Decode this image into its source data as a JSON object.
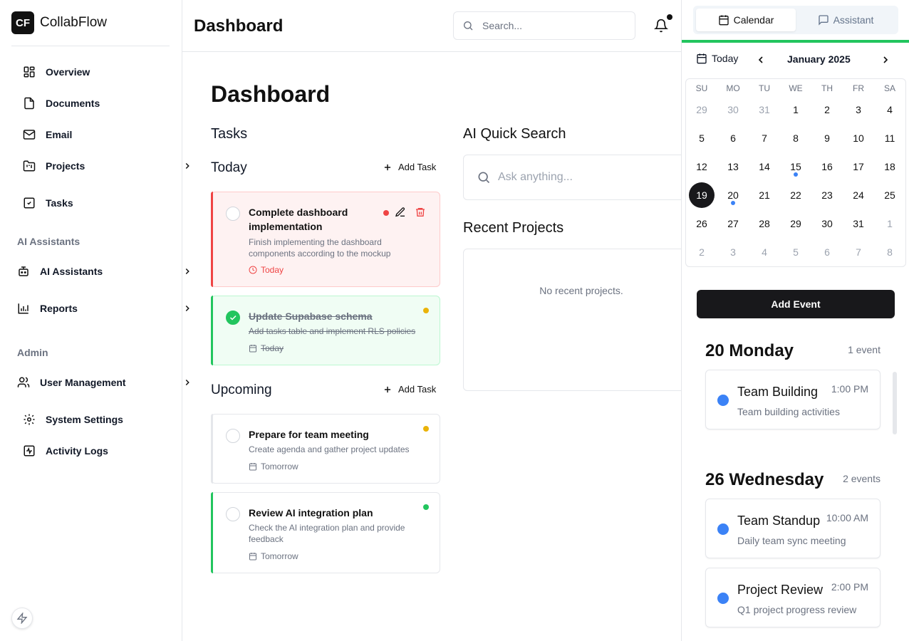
{
  "sidebar": {
    "brand_logo": "CF",
    "brand_name": "CollabFlow",
    "main_items": [
      {
        "label": "Overview",
        "icon": "grid-icon"
      },
      {
        "label": "Documents",
        "icon": "file-icon"
      },
      {
        "label": "Email",
        "icon": "mail-icon"
      },
      {
        "label": "Projects",
        "icon": "folder-icon"
      },
      {
        "label": "Tasks",
        "icon": "check-square-icon"
      }
    ],
    "ai_section_title": "AI Assistants",
    "ai_items": [
      {
        "label": "AI Assistants",
        "icon": "bot-icon"
      },
      {
        "label": "Reports",
        "icon": "bar-chart-icon"
      }
    ],
    "admin_section_title": "Admin",
    "admin_items": [
      {
        "label": "User Management",
        "icon": "users-icon"
      },
      {
        "label": "System Settings",
        "icon": "gear-icon"
      },
      {
        "label": "Activity Logs",
        "icon": "activity-icon"
      }
    ]
  },
  "header": {
    "title": "Dashboard",
    "search_placeholder": "Search..."
  },
  "main": {
    "title": "Dashboard",
    "tasks_heading": "Tasks",
    "today_heading": "Today",
    "upcoming_heading": "Upcoming",
    "add_task_label": "Add Task",
    "today_tasks": [
      {
        "title": "Complete dashboard implementation",
        "description": "Finish implementing the dashboard components according to the mockup",
        "due": "Today",
        "priority_color": "#ef4444",
        "completed": false
      },
      {
        "title": "Update Supabase schema",
        "description": "Add tasks table and implement RLS policies",
        "due": "Today",
        "priority_color": "#eab308",
        "completed": true
      }
    ],
    "upcoming_tasks": [
      {
        "title": "Prepare for team meeting",
        "description": "Create agenda and gather project updates",
        "due": "Tomorrow",
        "priority_color": "#eab308",
        "completed": false
      },
      {
        "title": "Review AI integration plan",
        "description": "Check the AI integration plan and provide feedback",
        "due": "Tomorrow",
        "priority_color": "#22c55e",
        "completed": false
      }
    ],
    "ai_search_heading": "AI Quick Search",
    "ai_search_placeholder": "Ask anything...",
    "recent_projects_heading": "Recent Projects",
    "recent_projects_empty": "No recent projects."
  },
  "right_panel": {
    "tabs": [
      {
        "label": "Calendar",
        "icon": "calendar-icon",
        "active": true
      },
      {
        "label": "Assistant",
        "icon": "message-icon",
        "active": false
      }
    ],
    "today_button": "Today",
    "month_label": "January 2025",
    "weekdays": [
      "SU",
      "MO",
      "TU",
      "WE",
      "TH",
      "FR",
      "SA"
    ],
    "days": [
      {
        "n": "29",
        "muted": true
      },
      {
        "n": "30",
        "muted": true
      },
      {
        "n": "31",
        "muted": true
      },
      {
        "n": "1"
      },
      {
        "n": "2"
      },
      {
        "n": "3"
      },
      {
        "n": "4"
      },
      {
        "n": "5"
      },
      {
        "n": "6"
      },
      {
        "n": "7"
      },
      {
        "n": "8"
      },
      {
        "n": "9"
      },
      {
        "n": "10"
      },
      {
        "n": "11"
      },
      {
        "n": "12"
      },
      {
        "n": "13"
      },
      {
        "n": "14"
      },
      {
        "n": "15",
        "event": true
      },
      {
        "n": "16"
      },
      {
        "n": "17"
      },
      {
        "n": "18"
      },
      {
        "n": "19",
        "today": true
      },
      {
        "n": "20",
        "event": true
      },
      {
        "n": "21"
      },
      {
        "n": "22"
      },
      {
        "n": "23"
      },
      {
        "n": "24"
      },
      {
        "n": "25"
      },
      {
        "n": "26"
      },
      {
        "n": "27"
      },
      {
        "n": "28"
      },
      {
        "n": "29"
      },
      {
        "n": "30"
      },
      {
        "n": "31"
      },
      {
        "n": "1",
        "muted": true
      },
      {
        "n": "2",
        "muted": true
      },
      {
        "n": "3",
        "muted": true
      },
      {
        "n": "4",
        "muted": true
      },
      {
        "n": "5",
        "muted": true
      },
      {
        "n": "6",
        "muted": true
      },
      {
        "n": "7",
        "muted": true
      },
      {
        "n": "8",
        "muted": true
      }
    ],
    "add_event_label": "Add Event",
    "event_groups": [
      {
        "heading": "20 Monday",
        "count": "1 event",
        "events": [
          {
            "title": "Team Building",
            "time": "1:00 PM",
            "description": "Team building activities"
          }
        ]
      },
      {
        "heading": "26 Wednesday",
        "count": "2 events",
        "events": [
          {
            "title": "Team Standup",
            "time": "10:00 AM",
            "description": "Daily team sync meeting"
          },
          {
            "title": "Project Review",
            "time": "2:00 PM",
            "description": "Q1 project progress review"
          }
        ]
      }
    ],
    "accent_color": "#22c55e",
    "event_color": "#3b82f6"
  }
}
